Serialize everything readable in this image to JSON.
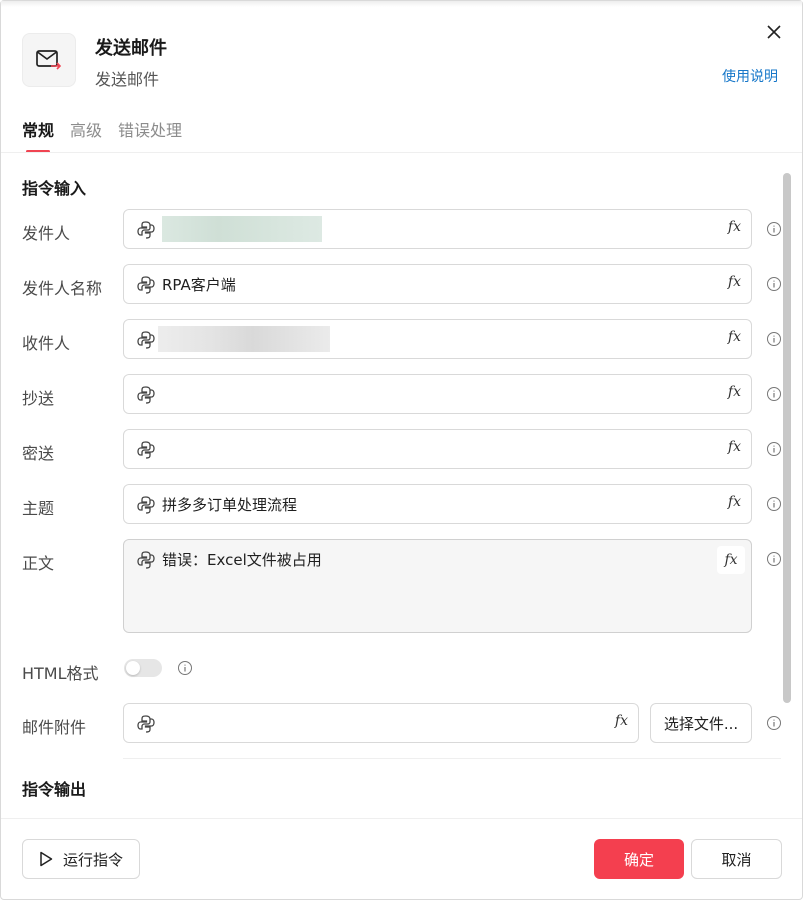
{
  "header": {
    "title": "发送邮件",
    "subtitle": "发送邮件",
    "help_link": "使用说明",
    "icon": "mail-send-icon",
    "close_icon": "close-icon"
  },
  "tabs": [
    {
      "label": "常规",
      "active": true
    },
    {
      "label": "高级",
      "active": false
    },
    {
      "label": "错误处理",
      "active": false
    }
  ],
  "sections": {
    "input_title": "指令输入",
    "output_title": "指令输出"
  },
  "fields": {
    "sender": {
      "label": "发件人",
      "value": ""
    },
    "sender_name": {
      "label": "发件人名称",
      "value": "RPA客户端"
    },
    "recipient": {
      "label": "收件人",
      "value": ""
    },
    "cc": {
      "label": "抄送",
      "value": ""
    },
    "bcc": {
      "label": "密送",
      "value": ""
    },
    "subject": {
      "label": "主题",
      "value": "拼多多订单处理流程"
    },
    "body": {
      "label": "正文",
      "value": "错误：Excel文件被占用"
    },
    "html_format": {
      "label": "HTML格式",
      "enabled": false
    },
    "attachment": {
      "label": "邮件附件",
      "value": "",
      "button": "选择文件..."
    }
  },
  "fx_label": "fx",
  "footer": {
    "run_label": "运行指令",
    "confirm_label": "确定",
    "cancel_label": "取消"
  },
  "colors": {
    "accent": "#f43f4f",
    "link": "#1677c9"
  }
}
